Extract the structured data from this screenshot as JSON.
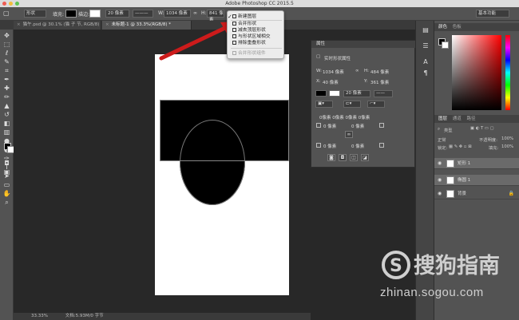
{
  "app": {
    "title": "Adobe Photoshop CC 2015.5"
  },
  "options_bar": {
    "tool_mode": "形状",
    "fill_label": "填充:",
    "stroke_label": "描边:",
    "stroke_width": "20 像素",
    "w_label": "W:",
    "w_value": "1034 像素",
    "link_icon": "link-icon",
    "h_label": "H:",
    "h_value": "841 像素",
    "workspace": "基本功能"
  },
  "tabs": [
    {
      "label": "猫午.psd @ 30.1% (猫 子 节, RGB/8)"
    },
    {
      "label": "未标题-1 @ 33.3%(RGB/8) *"
    }
  ],
  "path_ops_menu": {
    "items": [
      {
        "label": "新建图层",
        "checked": true
      },
      {
        "label": "合并形状"
      },
      {
        "label": "减去顶层形状"
      },
      {
        "label": "与形状区域相交"
      },
      {
        "label": "排除重叠形状"
      },
      {
        "label": "合并形状组件",
        "disabled": true
      }
    ]
  },
  "properties": {
    "title": "属性",
    "section": "实时形状属性",
    "w_label": "W:",
    "w_value": "1034 像素",
    "h_label": "H:",
    "h_value": "484 像素",
    "x_label": "X:",
    "x_value": "40 像素",
    "y_label": "Y:",
    "y_value": "361 像素",
    "stroke_width": "20 像素",
    "corner_summary": "0像素 0像素 0像素 0像素",
    "corner_tl": "0 像素",
    "corner_tr": "0 像素",
    "corner_bl": "0 像素",
    "corner_br": "0 像素"
  },
  "color_panel": {
    "tabs": [
      "颜色",
      "色板"
    ],
    "foreground": "#000000",
    "background": "#ffffff"
  },
  "layers_panel": {
    "tabs": [
      "图层",
      "通道",
      "路径"
    ],
    "kind_filter": "类型",
    "blend_mode": "正常",
    "opacity_label": "不透明度:",
    "opacity_value": "100%",
    "lock_label": "锁定:",
    "fill_label": "填充:",
    "fill_value": "100%",
    "layers": [
      {
        "name": "矩形 1",
        "selected": true
      },
      {
        "name": "椭圆 1",
        "selected": true
      },
      {
        "name": "背景",
        "selected": false
      }
    ]
  },
  "status_bar": {
    "zoom": "33.33%",
    "doc_info": "文档:5.93M/0 字节"
  },
  "watermark": {
    "brand": "搜狗指南",
    "url": "zhinan.sogou.com"
  },
  "colors": {
    "annotation_arrow": "#cc1b1b",
    "panel_bg": "#535353",
    "canvas_bg": "#282828"
  }
}
